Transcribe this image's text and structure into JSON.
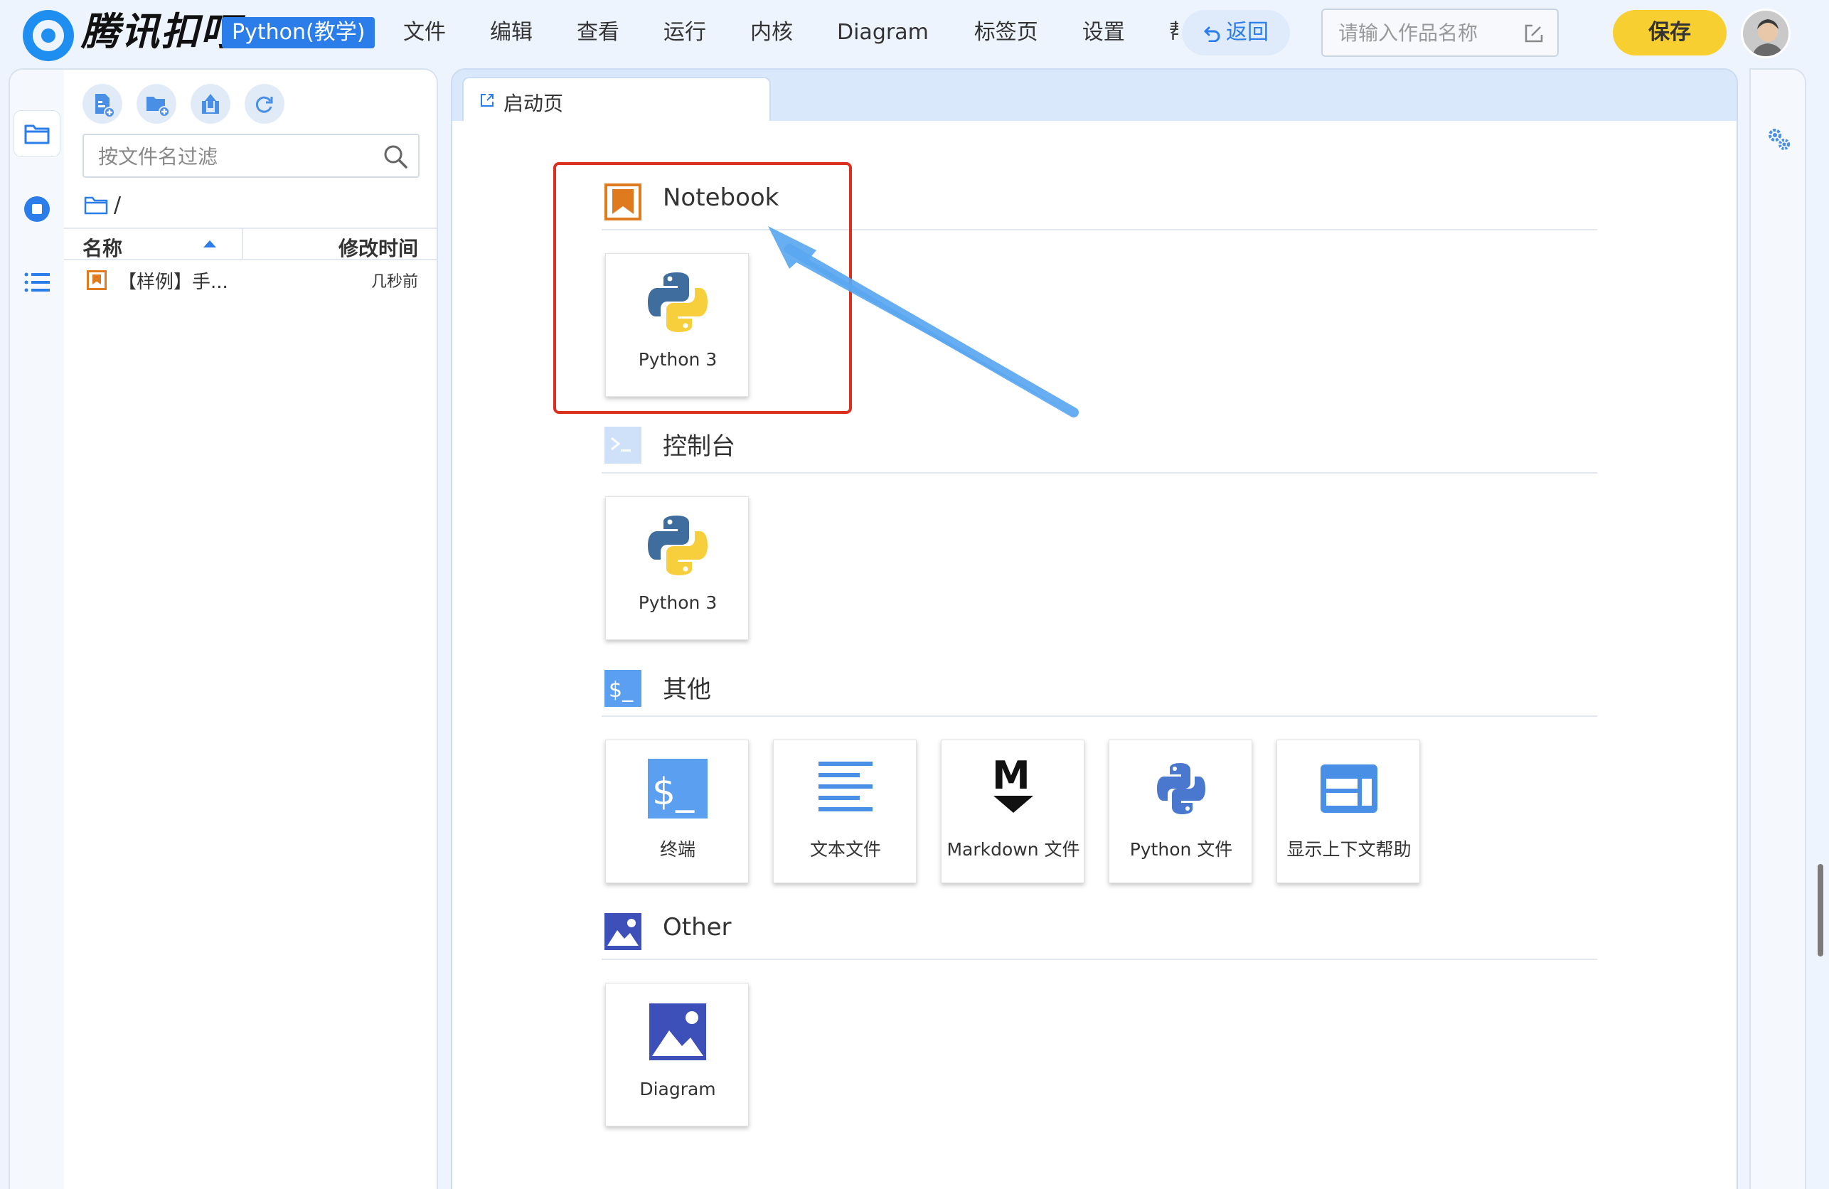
{
  "app": {
    "brand_name": "腾讯扣叮",
    "edition": "Python(教学)"
  },
  "menu": [
    "文件",
    "编辑",
    "查看",
    "运行",
    "内核",
    "Diagram",
    "标签页",
    "设置",
    "帮助"
  ],
  "header": {
    "back_label": "返回",
    "title_placeholder": "请输入作品名称",
    "save_label": "保存"
  },
  "file_browser": {
    "filter_placeholder": "按文件名过滤",
    "path": "/",
    "col_name": "名称",
    "col_modified": "修改时间",
    "files": [
      {
        "name": "【样例】手...",
        "modified": "几秒前",
        "icon": "notebook-icon"
      }
    ]
  },
  "tabs": [
    {
      "label": "启动页",
      "icon": "launcher-icon"
    }
  ],
  "launcher": {
    "sections": [
      {
        "title": "Notebook",
        "icon": "notebook-icon",
        "items": [
          {
            "label": "Python 3",
            "icon": "python-icon"
          }
        ]
      },
      {
        "title": "控制台",
        "icon": "console-icon",
        "items": [
          {
            "label": "Python 3",
            "icon": "python-icon"
          }
        ]
      },
      {
        "title": "其他",
        "icon": "other-terminal-icon",
        "items": [
          {
            "label": "终端",
            "icon": "terminal-icon"
          },
          {
            "label": "文本文件",
            "icon": "text-file-icon"
          },
          {
            "label": "Markdown 文件",
            "icon": "markdown-icon"
          },
          {
            "label": "Python 文件",
            "icon": "python-file-icon"
          },
          {
            "label": "显示上下文帮助",
            "icon": "context-help-icon"
          }
        ]
      },
      {
        "title": "Other",
        "icon": "image-icon",
        "items": [
          {
            "label": "Diagram",
            "icon": "diagram-icon"
          }
        ]
      }
    ]
  },
  "annotation": {
    "highlight_color": "#d9301f",
    "arrow_color": "#5aa8f0"
  },
  "colors": {
    "accent": "#2b7de9",
    "save": "#f8cf30",
    "notebook_orange": "#e07a1f"
  }
}
